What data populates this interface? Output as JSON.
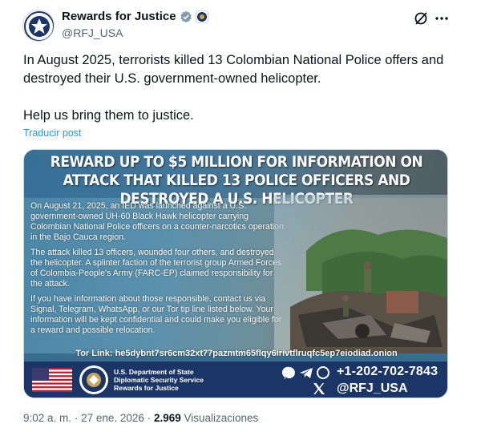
{
  "account": {
    "display_name": "Rewards for Justice",
    "handle": "@RFJ_USA",
    "avatar_icon": "rfj-seal-icon",
    "verified_icon": "verified-badge-icon",
    "affiliation_icon": "gov-seal-badge-icon"
  },
  "actions": {
    "grok_icon": "grok-icon",
    "more_icon": "more-dots-icon"
  },
  "tweet": {
    "text_line1": "In August 2025, terrorists killed 13 Colombian National Police offers and destroyed their U.S. government-owned helicopter.",
    "text_line2": "Help us bring them to justice.",
    "translate": "Traducir post"
  },
  "media": {
    "headline": "REWARD UP TO $5 MILLION FOR INFORMATION ON ATTACK THAT KILLED 13 POLICE OFFICERS AND DESTROYED A U.S. HELICOPTER",
    "para1": "On August 21, 2025, an IED was launched against a U.S. government-owned UH-60 Black Hawk helicopter carrying Colombian National Police officers on a counter-narcotics operation in the Bajo Cauca region.",
    "para2": "The attack killed 13 officers, wounded four others, and destroyed the helicopter. A splinter faction of the terrorist group Armed Forces of Colombia-People's Army (FARC-EP) claimed responsibility for the attack.",
    "para3": "If you have information about those responsible, contact us via Signal, Telegram, WhatsApp, or our Tor tip line listed below. Your information will be kept confidential and could make you eligible for a reward and possible relocation.",
    "tor_link": "Tor Link: he5dybnt7sr6cm32xt77pazmtm65flqy6irivtflruqfc5ep7eiodiad.onion",
    "agency_line1": "U.S. Department of State",
    "agency_line2": "Diplomatic Security Service",
    "agency_line3": "Rewards for Justice",
    "phone": "+1-202-702-7843",
    "x_handle": "@RFJ_USA"
  },
  "meta": {
    "time": "9:02 a. m.",
    "separator": "·",
    "date": "27 ene. 2026",
    "views_count": "2.969",
    "views_label": "Visualizaciones"
  }
}
